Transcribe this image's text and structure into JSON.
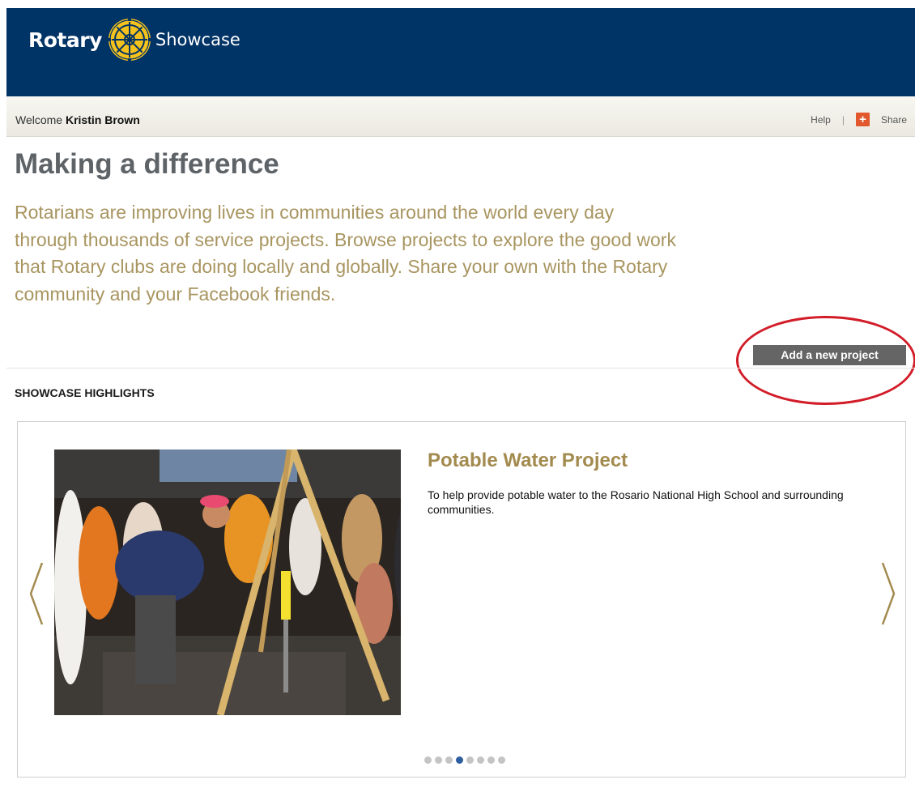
{
  "header": {
    "brand_rotary": "Rotary",
    "brand_showcase": "Showcase",
    "colors": {
      "navy": "#003366",
      "gold": "#f5c21d"
    }
  },
  "welcome_bar": {
    "welcome_prefix": "Welcome",
    "user_name": "Kristin Brown",
    "help_label": "Help",
    "share_icon_glyph": "+",
    "share_label": "Share"
  },
  "main": {
    "title": "Making a difference",
    "intro": "Rotarians are improving lives in communities around the world every day through thousands of service projects. Browse projects to explore the good work that Rotary clubs are doing locally and globally. Share your own with the Rotary community and your Facebook friends.",
    "add_project_label": "Add a new project",
    "highlight_color": "#d21d29"
  },
  "highlights": {
    "section_title": "SHOWCASE HIGHLIGHTS",
    "slide": {
      "title": "Potable Water Project",
      "description": "To help provide potable water to the Rosario National High School and surrounding communities."
    },
    "dots_total": 8,
    "active_dot_index": 3,
    "icons": {
      "prev": "chevron-left-icon",
      "next": "chevron-right-icon"
    }
  }
}
